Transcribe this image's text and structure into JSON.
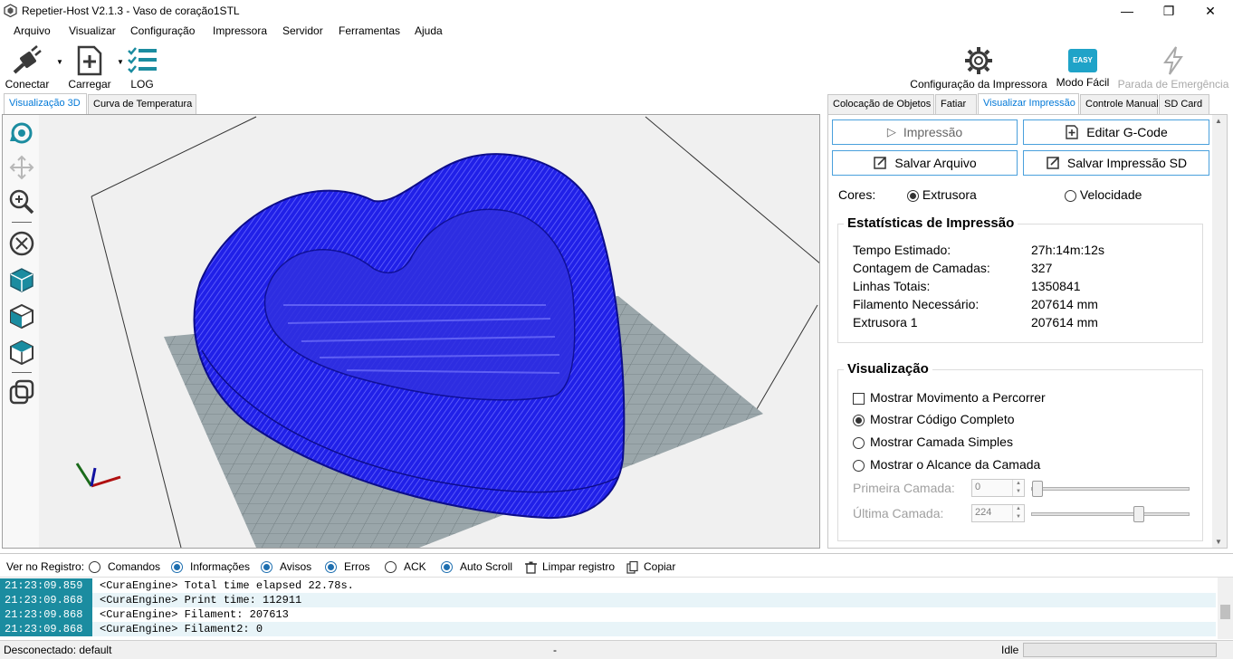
{
  "window": {
    "title": "Repetier-Host V2.1.3 - Vaso de coração1STL",
    "minimize": "—",
    "maximize": "❐",
    "close": "✕"
  },
  "menu": [
    "Arquivo",
    "Visualizar",
    "Configuração",
    "Impressora",
    "Servidor",
    "Ferramentas",
    "Ajuda"
  ],
  "toolbar": {
    "connect": "Conectar",
    "load": "Carregar",
    "log": "LOG",
    "printer_config": "Configuração da Impressora",
    "easy_mode": "Modo Fácil",
    "easy_badge": "EASY",
    "emergency": "Parada de Emergência"
  },
  "left_tabs": [
    "Visualização 3D",
    "Curva de Temperatura"
  ],
  "right_tabs": [
    "Colocação de Objetos",
    "Fatiar",
    "Visualizar Impressão",
    "Controle Manual",
    "SD Card"
  ],
  "actions": {
    "print": "Impressão",
    "edit_gcode": "Editar G-Code",
    "save_file": "Salvar Arquivo",
    "save_sd": "Salvar Impressão SD"
  },
  "colors": {
    "label": "Cores:",
    "extruder": "Extrusora",
    "speed": "Velocidade",
    "model_blue": "#1a1ad8",
    "accent": "#0078d7",
    "log_time_bg": "#1b8ca0"
  },
  "stats": {
    "title": "Estatísticas de Impressão",
    "rows": [
      {
        "label": "Tempo Estimado:",
        "value": "27h:14m:12s"
      },
      {
        "label": "Contagem de Camadas:",
        "value": "327"
      },
      {
        "label": "Linhas Totais:",
        "value": "1350841"
      },
      {
        "label": "Filamento Necessário:",
        "value": "207614 mm"
      },
      {
        "label": "Extrusora 1",
        "value": "207614 mm"
      }
    ]
  },
  "visualization": {
    "title": "Visualização",
    "show_travel": "Mostrar Movimento a Percorrer",
    "show_complete": "Mostrar Código Completo",
    "show_single": "Mostrar Camada Simples",
    "show_range": "Mostrar o Alcance da Camada",
    "first_layer_label": "Primeira Camada:",
    "first_layer_value": "0",
    "last_layer_label": "Última Camada:",
    "last_layer_value": "224",
    "first_layer_fraction": 0,
    "last_layer_fraction": 0.685
  },
  "log": {
    "filter_label": "Ver no Registro:",
    "commands": "Comandos",
    "info": "Informações",
    "warnings": "Avisos",
    "errors": "Erros",
    "ack": "ACK",
    "autoscroll": "Auto Scroll",
    "clear": "Limpar registro",
    "copy": "Copiar",
    "rows": [
      {
        "time": "21:23:09.859",
        "msg": "<CuraEngine> Total time elapsed 22.78s."
      },
      {
        "time": "21:23:09.868",
        "msg": "<CuraEngine> Print time: 112911"
      },
      {
        "time": "21:23:09.868",
        "msg": "<CuraEngine> Filament: 207613"
      },
      {
        "time": "21:23:09.868",
        "msg": "<CuraEngine> Filament2: 0"
      }
    ]
  },
  "status": {
    "connection": "Desconectado: default",
    "middle": "-",
    "state": "Idle"
  }
}
